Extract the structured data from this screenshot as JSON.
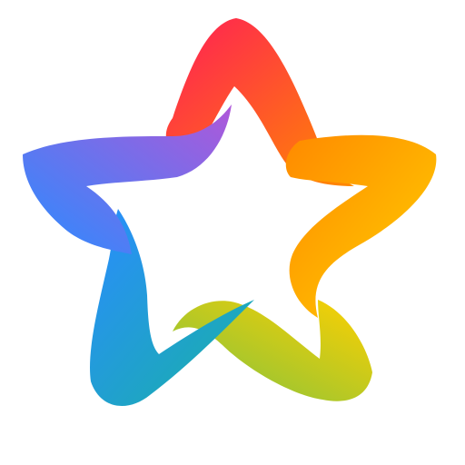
{
  "logo": {
    "icon": "rainbow-star-icon",
    "colors": {
      "red": "#FF1E56",
      "orange": "#FF8A00",
      "yellow": "#FFD000",
      "green": "#7CC242",
      "teal": "#18B2A4",
      "blue": "#2A8CFF",
      "purple": "#B057D9"
    }
  }
}
